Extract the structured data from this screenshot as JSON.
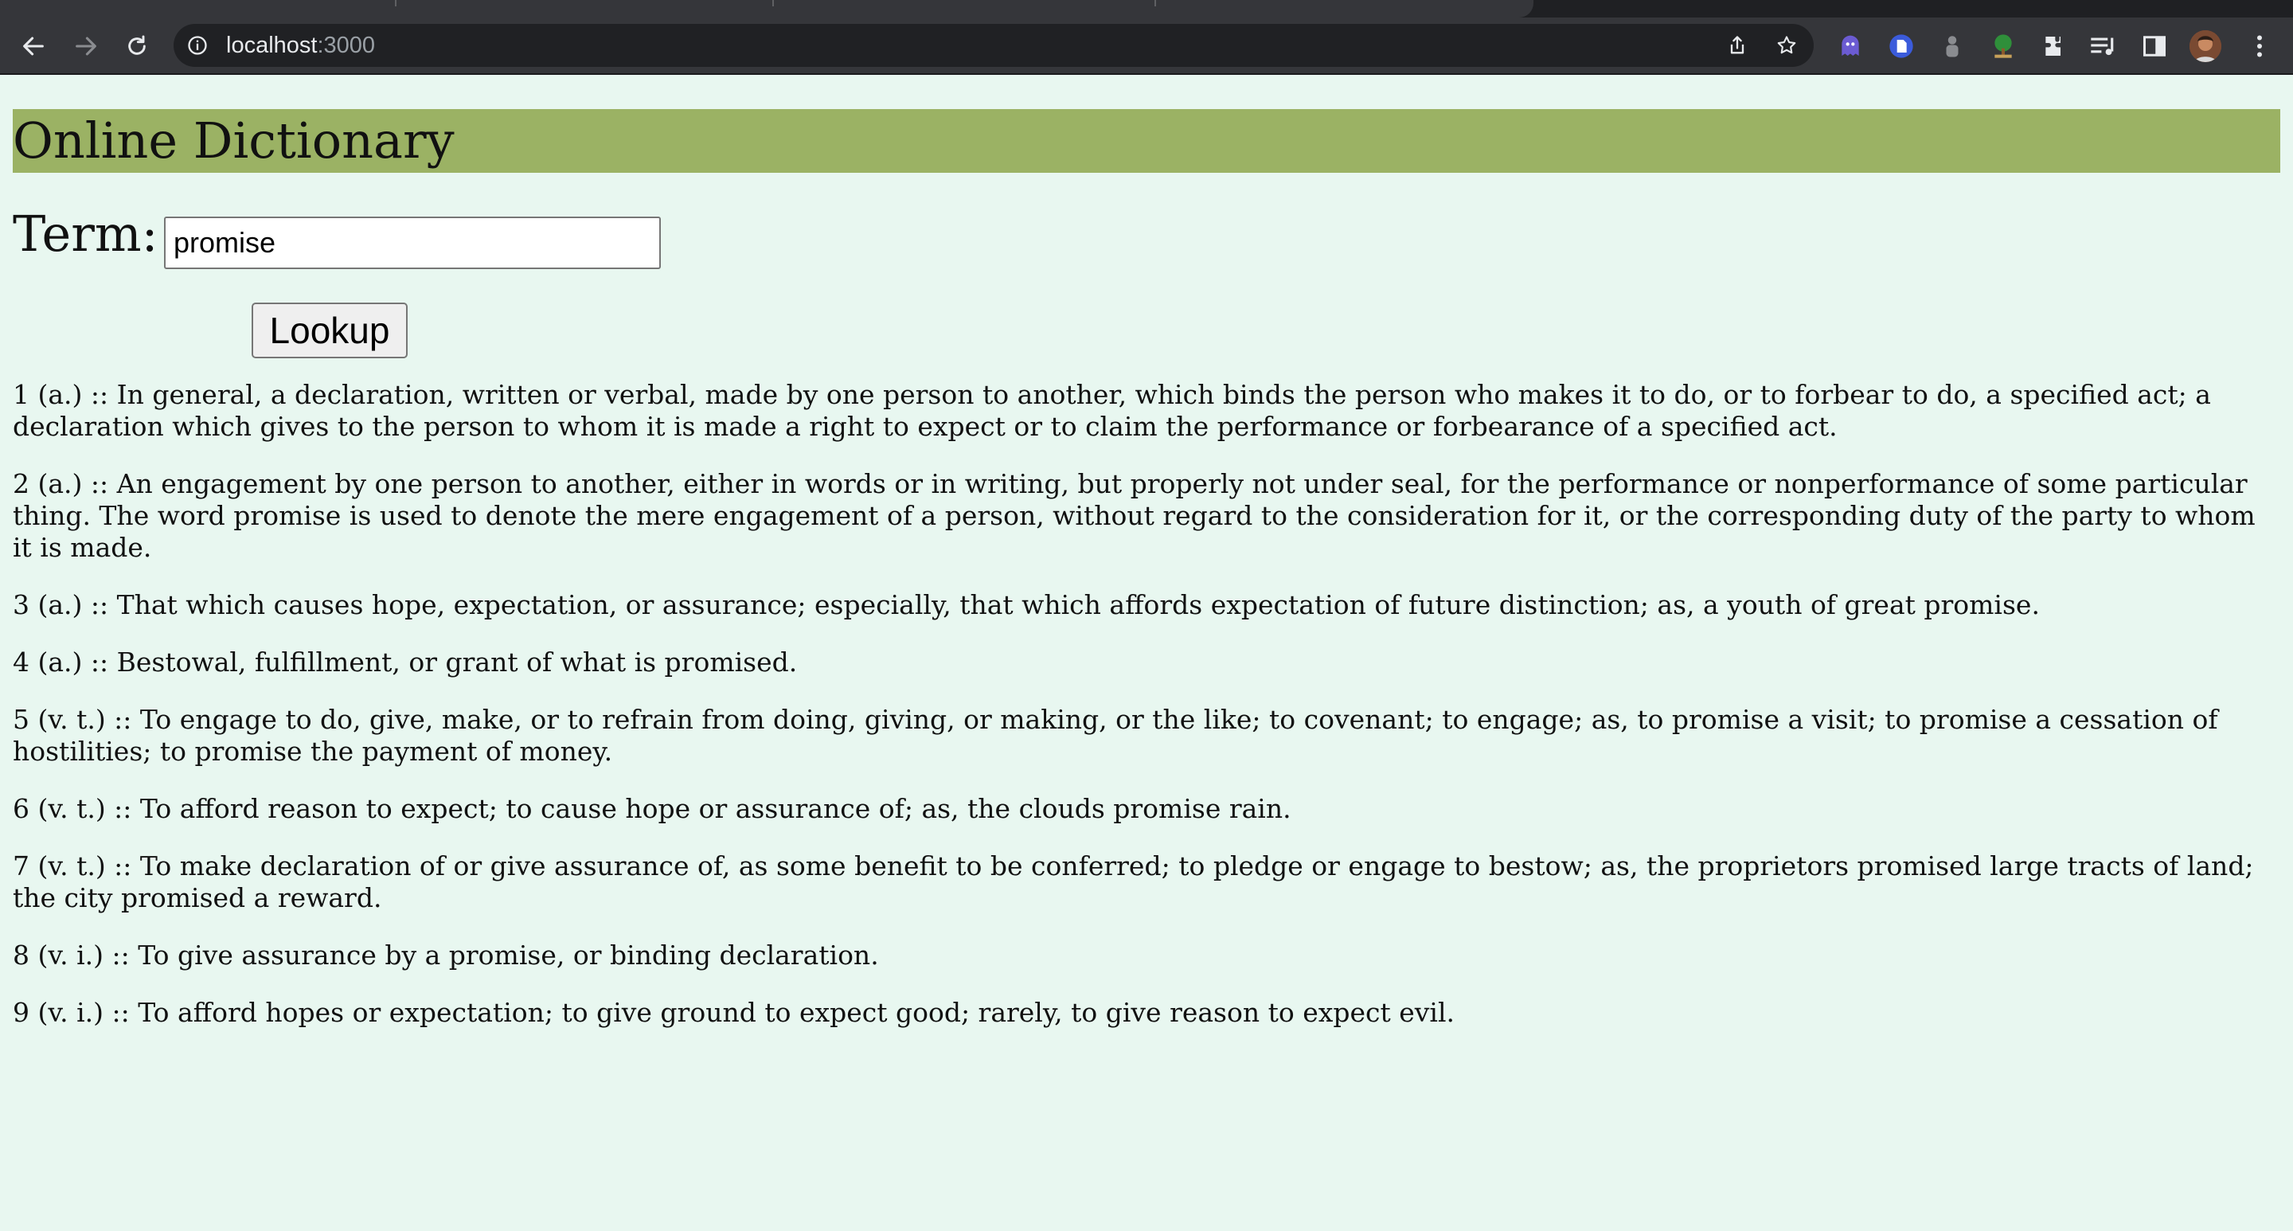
{
  "browser": {
    "url_host": "localhost",
    "url_port": ":3000"
  },
  "page": {
    "title": "Online Dictionary",
    "term_label": "Term:",
    "term_value": "promise",
    "lookup_label": "Lookup"
  },
  "definitions": [
    "1 (a.) :: In general, a declaration, written or verbal, made by one person to another, which binds the person who makes it to do, or to forbear to do, a specified act; a declaration which gives to the person to whom it is made a right to expect or to claim the performance or forbearance of a specified act.",
    "2 (a.) :: An engagement by one person to another, either in words or in writing, but properly not under seal, for the performance or nonperformance of some particular thing. The word promise is used to denote the mere engagement of a person, without regard to the consideration for it, or the corresponding duty of the party to whom it is made.",
    "3 (a.) :: That which causes hope, expectation, or assurance; especially, that which affords expectation of future distinction; as, a youth of great promise.",
    "4 (a.) :: Bestowal, fulfillment, or grant of what is promised.",
    "5 (v. t.) :: To engage to do, give, make, or to refrain from doing, giving, or making, or the like; to covenant; to engage; as, to promise a visit; to promise a cessation of hostilities; to promise the payment of money.",
    "6 (v. t.) :: To afford reason to expect; to cause hope or assurance of; as, the clouds promise rain.",
    "7 (v. t.) :: To make declaration of or give assurance of, as some benefit to be conferred; to pledge or engage to bestow; as, the proprietors promised large tracts of land; the city promised a reward.",
    "8 (v. i.) :: To give assurance by a promise, or binding declaration.",
    "9 (v. i.) :: To afford hopes or expectation; to give ground to expect good; rarely, to give reason to expect evil."
  ]
}
